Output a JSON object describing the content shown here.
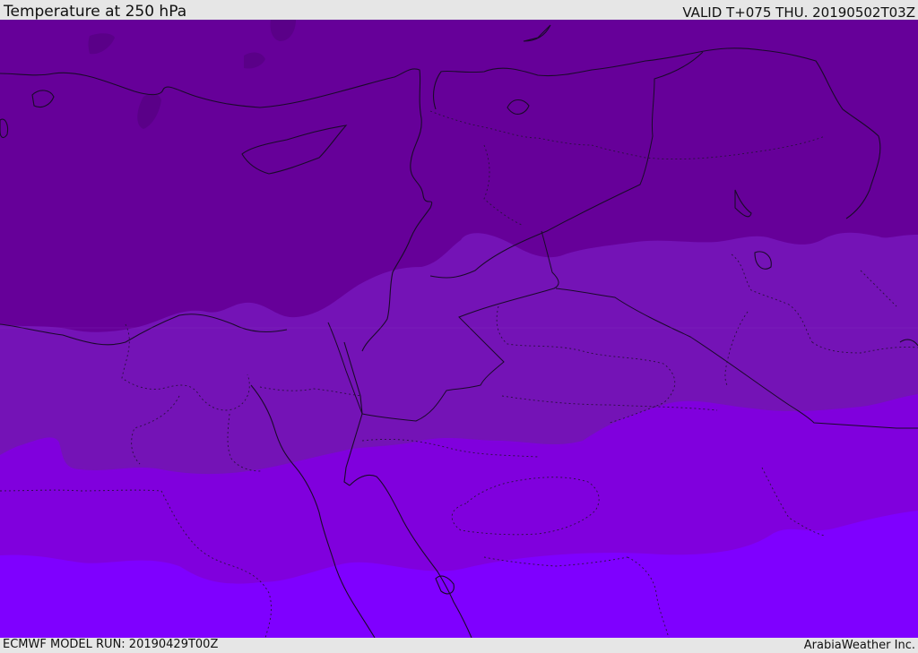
{
  "header": {
    "title": "Temperature at 250 hPa",
    "valid": "VALID T+075 THU. 20190502T03Z"
  },
  "footer": {
    "model_run": "ECMWF MODEL RUN: 20190429T00Z",
    "credit": "ArabiaWeather Inc."
  },
  "map": {
    "colors": {
      "band_coldest": "#660099",
      "band_2": "#7413b6",
      "band_3": "#8000dd",
      "band_warmest": "#7f00ff",
      "coastline": "#1a0a2a",
      "border_dotted": "#2a1040"
    }
  }
}
